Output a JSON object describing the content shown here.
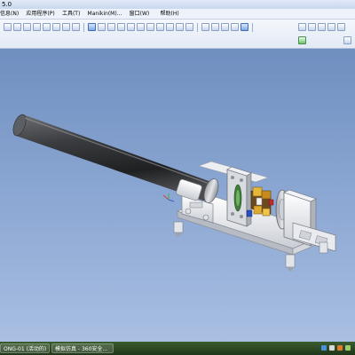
{
  "window": {
    "title": "5.0"
  },
  "menu": {
    "items": [
      "信息(N)",
      "应用程序(P)",
      "工具(T)",
      "Manikin(M)...",
      "窗口(W)",
      "帮助(H)"
    ]
  },
  "taskbar": {
    "tasks": [
      "ONG-01 (活动的)",
      "模拟仿真 - 360安全..."
    ]
  }
}
